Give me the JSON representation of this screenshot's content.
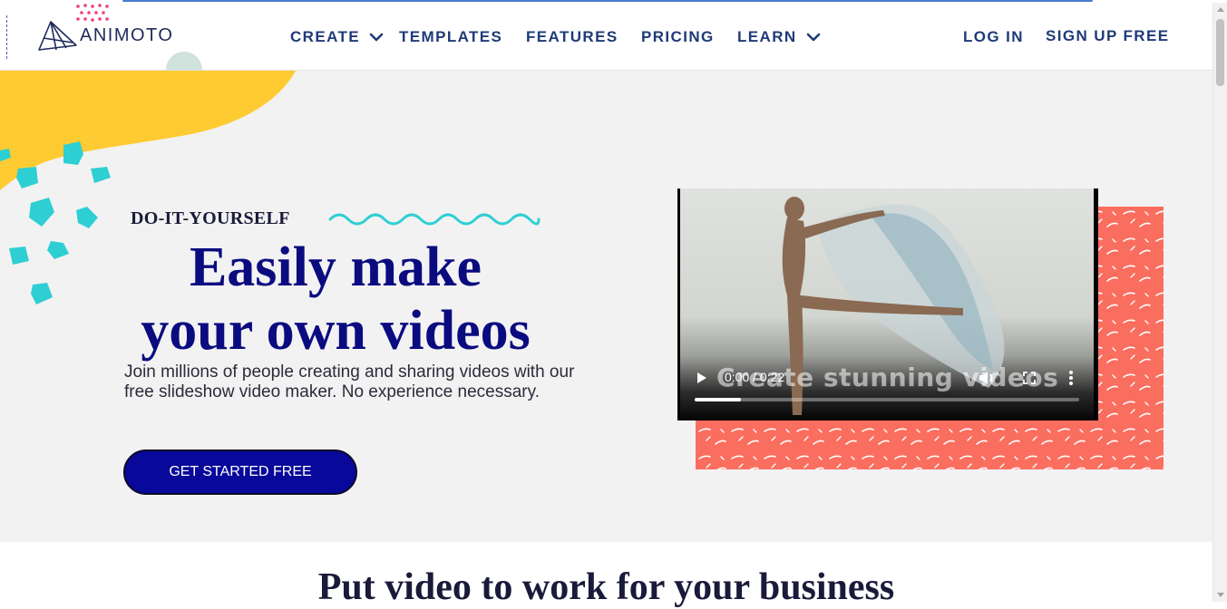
{
  "brand": {
    "name": "ANIMOTO"
  },
  "nav": {
    "create": "CREATE",
    "templates": "TEMPLATES",
    "features": "FEATURES",
    "pricing": "PRICING",
    "learn": "LEARN",
    "login": "LOG IN",
    "signup": "SIGN UP FREE"
  },
  "hero": {
    "eyebrow": "DO-IT-YOURSELF",
    "headline_line1": "Easily make",
    "headline_line2": "your own videos",
    "description": "Join millions of people creating and sharing videos with our free slideshow video maker. No experience necessary.",
    "cta": "GET STARTED FREE"
  },
  "video": {
    "overlay_text": "Create stunning videos",
    "time": "0:00 / 0:22",
    "progress": 0.12
  },
  "section": {
    "title": "Put video to work for your business"
  },
  "colors": {
    "navy": "#0b0b80",
    "nav_text": "#1f3a78",
    "yellow": "#ffcb32",
    "teal": "#2ecfd3",
    "coral": "#fa6e5f"
  }
}
